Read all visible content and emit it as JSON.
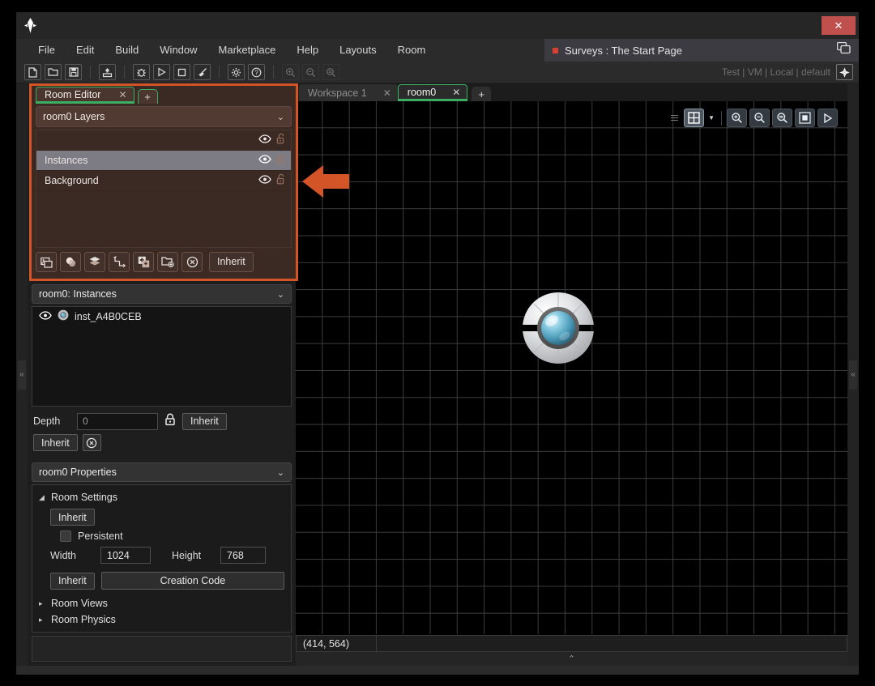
{
  "window": {
    "logo_icon": "gamemaker-diamond-icon",
    "close_label": "✕"
  },
  "menubar": {
    "items": [
      {
        "label": "File"
      },
      {
        "label": "Edit"
      },
      {
        "label": "Build"
      },
      {
        "label": "Window"
      },
      {
        "label": "Marketplace"
      },
      {
        "label": "Help"
      },
      {
        "label": "Layouts"
      },
      {
        "label": "Room"
      }
    ],
    "project_tab": {
      "title": "Surveys : The Start Page",
      "chat_icon": "chat-bubbles-icon",
      "modified_dot": "#d9402f"
    }
  },
  "toolbar": {
    "buttons": [
      {
        "name": "new-file-icon"
      },
      {
        "name": "open-folder-icon"
      },
      {
        "name": "save-icon"
      },
      {
        "name": "export-icon"
      },
      {
        "name": "debug-bug-icon"
      },
      {
        "name": "run-play-icon"
      },
      {
        "name": "stop-square-icon"
      },
      {
        "name": "clean-broom-icon"
      },
      {
        "name": "preferences-gear-icon"
      },
      {
        "name": "help-question-icon"
      },
      {
        "name": "zoom-in-icon"
      },
      {
        "name": "zoom-out-icon"
      },
      {
        "name": "zoom-reset-icon"
      }
    ],
    "status_text": "Test | VM | Local | default",
    "target_icon": "target-crosshair-icon"
  },
  "room_editor": {
    "tab": {
      "label": "Room Editor",
      "close": "✕",
      "add": "+"
    },
    "layers_panel": {
      "title": "room0 Layers",
      "chevron": "⌄",
      "rows": [
        {
          "label": "",
          "blank": true,
          "eye": "eye-icon",
          "lock": "unlock-icon",
          "selected": false
        },
        {
          "label": "Instances",
          "blank": false,
          "eye": "eye-icon",
          "lock": "unlock-icon",
          "selected": true
        },
        {
          "label": "Background",
          "blank": false,
          "eye": "eye-icon",
          "lock": "unlock-icon",
          "selected": false
        }
      ],
      "toolbar": [
        {
          "name": "add-background-layer-icon"
        },
        {
          "name": "add-asset-layer-icon"
        },
        {
          "name": "add-tile-layer-icon"
        },
        {
          "name": "add-path-layer-icon"
        },
        {
          "name": "add-instance-layer-icon"
        },
        {
          "name": "add-folder-icon"
        },
        {
          "name": "delete-layer-icon"
        }
      ],
      "inherit_label": "Inherit"
    }
  },
  "instances_panel": {
    "title": "room0: Instances",
    "chevron": "⌄",
    "items": [
      {
        "name": "inst_A4B0CEB",
        "eye": "eye-icon",
        "sprite": "sprite-thumb-icon"
      }
    ],
    "depth_label": "Depth",
    "depth_value": "0",
    "depth_placeholder": "0",
    "lock_icon": "lock-closed-icon",
    "inherit_label": "Inherit",
    "inherit2_label": "Inherit",
    "clear_icon": "clear-circle-x-icon"
  },
  "properties_panel": {
    "title": "room0 Properties",
    "chevron": "⌄",
    "room_settings_label": "Room Settings",
    "room_settings_tri": "◢",
    "inherit_label": "Inherit",
    "persistent_label": "Persistent",
    "width_label": "Width",
    "width_value": "1024",
    "height_label": "Height",
    "height_value": "768",
    "inherit2_label": "Inherit",
    "creation_code_label": "Creation Code",
    "room_views_label": "Room Views",
    "room_physics_label": "Room Physics",
    "collapsed_tri": "▸"
  },
  "workspace": {
    "tabs": [
      {
        "label": "Workspace 1",
        "close": "✕",
        "active": false
      },
      {
        "label": "room0",
        "close": "✕",
        "active": true
      }
    ],
    "add_tab": "+"
  },
  "canvas": {
    "toolbar": [
      {
        "name": "grid-toggle-icon",
        "active": true
      },
      {
        "name": "grid-options-caret-icon",
        "active": false
      },
      {
        "name": "zoom-in-icon",
        "active": false
      },
      {
        "name": "zoom-out-icon",
        "active": false
      },
      {
        "name": "zoom-reset-icon",
        "active": false
      },
      {
        "name": "fit-to-view-icon",
        "active": false
      },
      {
        "name": "run-room-icon",
        "active": false
      }
    ],
    "instance_sprite": "spaceship-orb-sprite",
    "annotation_arrow": {
      "name": "pointer-arrow-left",
      "color": "#d35427"
    },
    "grid_size_px": 33
  },
  "statusbar": {
    "coordinates": "(414, 564)",
    "collapse_chevron": "⌃"
  },
  "rails": {
    "left_collapse": "«",
    "right_collapse": "«"
  }
}
